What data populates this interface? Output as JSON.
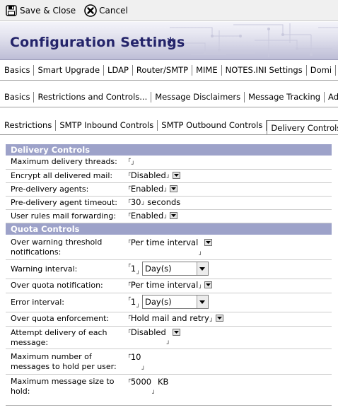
{
  "toolbar": {
    "save_close_label": "Save & Close",
    "cancel_label": "Cancel"
  },
  "header": {
    "title": "Configuration Settings",
    "dirty_marker": ": *"
  },
  "tabs_level1": [
    "Basics",
    "Smart Upgrade",
    "LDAP",
    "Router/SMTP",
    "MIME",
    "NOTES.INI Settings",
    "Domi"
  ],
  "tabs_level2": [
    "Basics",
    "Restrictions and Controls...",
    "Message Disclaimers",
    "Message Tracking",
    "Adv"
  ],
  "tabs_level3": [
    "Restrictions",
    "SMTP Inbound Controls",
    "SMTP Outbound Controls",
    "Delivery Controls"
  ],
  "delivery": {
    "header": "Delivery Controls",
    "max_threads_label": "Maximum delivery threads:",
    "max_threads_value": "",
    "encrypt_label": "Encrypt all delivered mail:",
    "encrypt_value": "Disabled",
    "predelivery_agents_label": "Pre-delivery agents:",
    "predelivery_agents_value": "Enabled",
    "predelivery_timeout_label": "Pre-delivery agent timeout:",
    "predelivery_timeout_value": "30",
    "predelivery_timeout_unit": "seconds",
    "user_rules_label": "User rules mail forwarding:",
    "user_rules_value": "Enabled"
  },
  "quota": {
    "header": "Quota Controls",
    "warn_threshold_label": "Over warning threshold notifications:",
    "warn_threshold_value": "Per time interval",
    "warn_interval_label": "Warning interval:",
    "warn_interval_value": "1",
    "warn_interval_unit": "Day(s)",
    "quota_notify_label": "Over quota notification:",
    "quota_notify_value": "Per time interval",
    "error_interval_label": "Error interval:",
    "error_interval_value": "1",
    "error_interval_unit": "Day(s)",
    "enforcement_label": "Over quota enforcement:",
    "enforcement_value": "Hold mail and retry",
    "attempt_label": "Attempt delivery of each message:",
    "attempt_value": "Disabled",
    "max_hold_label": "Maximum number of messages to hold per user:",
    "max_hold_value": "10",
    "max_size_label": "Maximum message size to hold:",
    "max_size_value": "5000",
    "max_size_unit": "KB"
  },
  "colors": {
    "section_header": "#9da2c9",
    "title_text": "#24246a"
  }
}
